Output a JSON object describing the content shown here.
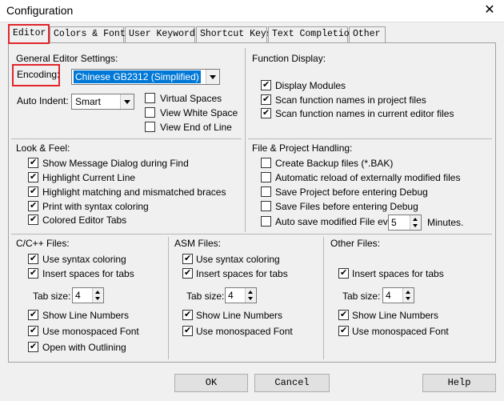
{
  "window": {
    "title": "Configuration",
    "close_glyph": "✕"
  },
  "tabs": [
    "Editor",
    "Colors & Fonts",
    "User Keywords",
    "Shortcut Keys",
    "Text Completion",
    "Other"
  ],
  "general": {
    "heading": "General Editor Settings:",
    "encoding_label": "Encoding:",
    "encoding_value": "Chinese GB2312 (Simplified)",
    "auto_indent_label": "Auto Indent:",
    "auto_indent_value": "Smart",
    "virtual_spaces": "Virtual Spaces",
    "view_white_space": "View White Space",
    "view_end_of_line": "View End of Line"
  },
  "function_display": {
    "heading": "Function Display:",
    "display_modules": "Display Modules",
    "scan_project": "Scan function names in project files",
    "scan_current": "Scan function names in current editor files"
  },
  "look_feel": {
    "heading": "Look & Feel:",
    "items": [
      "Show Message Dialog during Find",
      "Highlight Current Line",
      "Highlight matching and mismatched braces",
      "Print with syntax coloring",
      "Colored Editor Tabs"
    ]
  },
  "file_handling": {
    "heading": "File & Project Handling:",
    "items": [
      "Create Backup files (*.BAK)",
      "Automatic reload of externally modified files",
      "Save Project before entering Debug",
      "Save Files before entering Debug",
      "Auto save modified File every"
    ],
    "autosave_value": "5",
    "minutes_label": "Minutes."
  },
  "cpp_files": {
    "heading": "C/C++ Files:",
    "use_syntax": "Use syntax coloring",
    "insert_spaces": "Insert spaces for tabs",
    "tab_size_label": "Tab size:",
    "tab_size": "4",
    "show_line_numbers": "Show Line Numbers",
    "monospaced": "Use monospaced Font",
    "outlining": "Open with Outlining"
  },
  "asm_files": {
    "heading": "ASM Files:",
    "use_syntax": "Use syntax coloring",
    "insert_spaces": "Insert spaces for tabs",
    "tab_size_label": "Tab size:",
    "tab_size": "4",
    "show_line_numbers": "Show Line Numbers",
    "monospaced": "Use monospaced Font"
  },
  "other_files": {
    "heading": "Other Files:",
    "insert_spaces": "Insert spaces for tabs",
    "tab_size_label": "Tab size:",
    "tab_size": "4",
    "show_line_numbers": "Show Line Numbers",
    "monospaced": "Use monospaced Font"
  },
  "buttons": {
    "ok": "OK",
    "cancel": "Cancel",
    "help": "Help"
  },
  "colors": {
    "highlight_red": "#e0262b",
    "selection_blue": "#0078d7"
  }
}
